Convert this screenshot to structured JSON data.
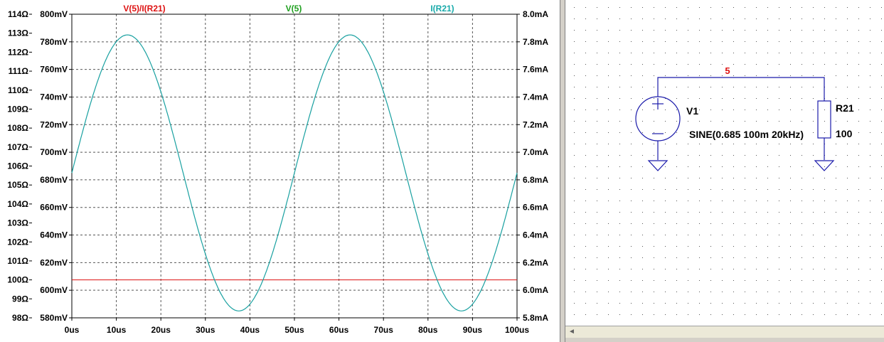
{
  "plot": {
    "traces": [
      {
        "label": "V(5)/I(R21)",
        "color": "#dd1111"
      },
      {
        "label": "V(5)",
        "color": "#1f9f1f"
      },
      {
        "label": "I(R21)",
        "color": "#18aaaa"
      }
    ],
    "ohm_axis_labels": [
      "114Ω",
      "113Ω",
      "112Ω",
      "111Ω",
      "110Ω",
      "109Ω",
      "108Ω",
      "107Ω",
      "106Ω",
      "105Ω",
      "104Ω",
      "103Ω",
      "102Ω",
      "101Ω",
      "100Ω",
      "99Ω",
      "98Ω"
    ],
    "volt_axis_labels": [
      "800mV",
      "780mV",
      "760mV",
      "740mV",
      "720mV",
      "700mV",
      "680mV",
      "660mV",
      "640mV",
      "620mV",
      "600mV",
      "580mV"
    ],
    "amp_axis_labels": [
      "8.0mA",
      "7.8mA",
      "7.6mA",
      "7.4mA",
      "7.2mA",
      "7.0mA",
      "6.8mA",
      "6.6mA",
      "6.4mA",
      "6.2mA",
      "6.0mA",
      "5.8mA"
    ],
    "time_axis_labels": [
      "0us",
      "10us",
      "20us",
      "30us",
      "40us",
      "50us",
      "60us",
      "70us",
      "80us",
      "90us",
      "100us"
    ]
  },
  "chart_data": {
    "type": "line",
    "x_unit": "us",
    "xlim": [
      0,
      100
    ],
    "ylim_voltage": [
      580,
      800
    ],
    "ylim_ohm": [
      98,
      114
    ],
    "grid": true,
    "series": [
      {
        "name": "I(R21)",
        "kind": "sine",
        "offset_mV": 685,
        "amplitude_mV": 100,
        "frequency_kHz": 20
      },
      {
        "name": "V(5)/I(R21)",
        "kind": "constant",
        "value_ohm": 100
      }
    ]
  },
  "schematic": {
    "net_label": "5",
    "source_name": "V1",
    "source_value": "SINE(0.685 100m 20kHz)",
    "resistor_name": "R21",
    "resistor_value": "100"
  },
  "scrollbar": {
    "left_arrow": "◄"
  }
}
